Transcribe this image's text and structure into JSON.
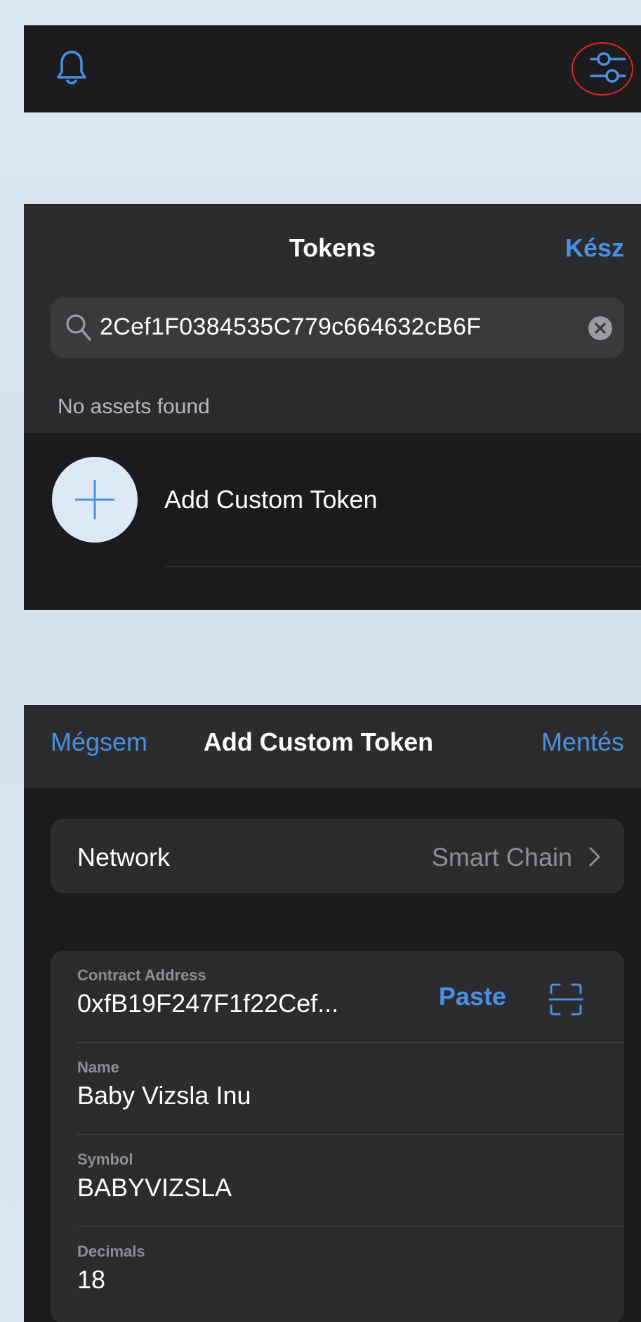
{
  "top_bar": {
    "left_icon": "bell-icon",
    "right_icon": "filter-sliders-icon",
    "highlight": "red circle around filter-sliders-icon",
    "accent_color": "#4a90e2",
    "highlight_color": "#e0222a"
  },
  "tokens_screen": {
    "title": "Tokens",
    "done_label": "Kész",
    "search": {
      "value": "2Cef1F0384535C779c664632cB6F",
      "icon": "search-icon",
      "clear_icon": "clear-icon"
    },
    "empty_message": "No assets found",
    "add_custom_token_label": "Add Custom Token",
    "add_icon": "plus-icon"
  },
  "add_token_screen": {
    "cancel_label": "Mégsem",
    "title": "Add Custom Token",
    "save_label": "Mentés",
    "network": {
      "label": "Network",
      "value": "Smart Chain"
    },
    "fields": {
      "contract": {
        "label": "Contract Address",
        "value": "0xfB19F247F1f22Cef...",
        "paste_label": "Paste"
      },
      "name": {
        "label": "Name",
        "value": "Baby Vizsla Inu"
      },
      "symbol": {
        "label": "Symbol",
        "value": "BABYVIZSLA"
      },
      "decimals": {
        "label": "Decimals",
        "value": "18"
      }
    }
  }
}
